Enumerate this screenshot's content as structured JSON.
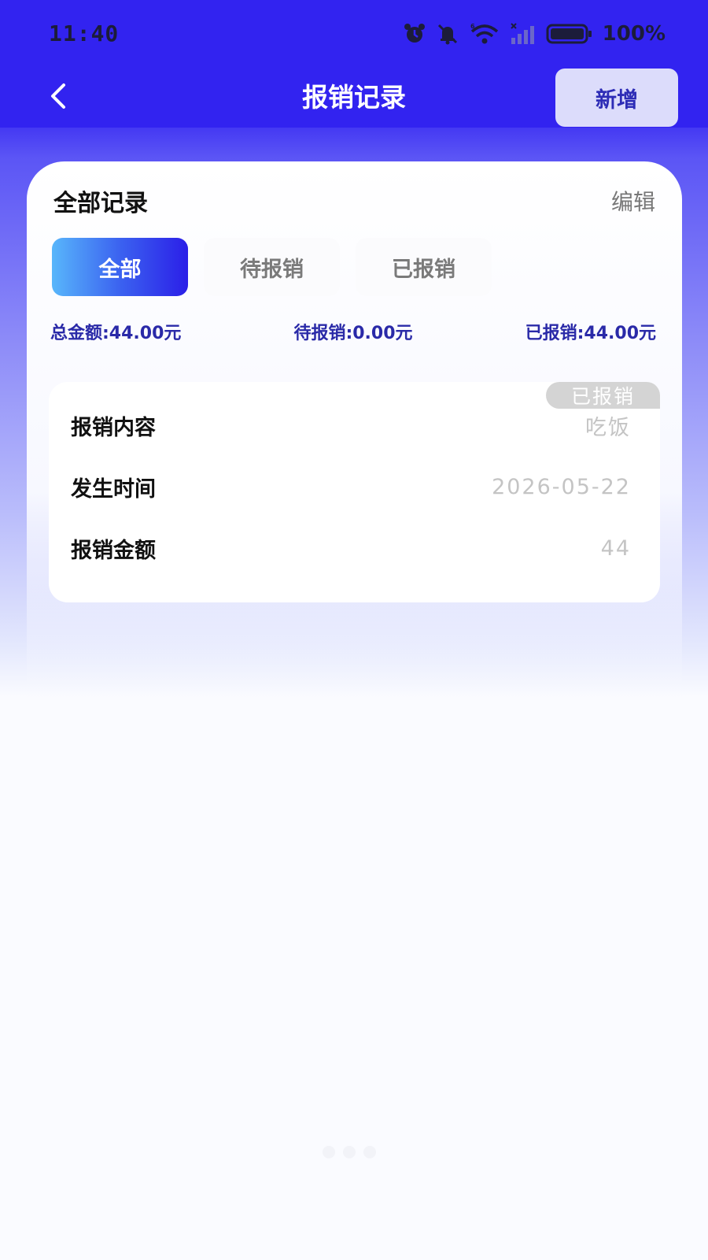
{
  "status_bar": {
    "time": "11:40",
    "battery_percent": "100%",
    "icons": [
      "alarm-icon",
      "mute-icon",
      "wifi-icon",
      "signal-icon",
      "battery-icon"
    ]
  },
  "nav": {
    "title": "报销记录",
    "add_label": "新增",
    "back_icon": "chevron-left-icon"
  },
  "card": {
    "title": "全部记录",
    "edit_label": "编辑",
    "tabs": [
      {
        "label": "全部",
        "active": true
      },
      {
        "label": "待报销",
        "active": false
      },
      {
        "label": "已报销",
        "active": false
      }
    ],
    "summary": {
      "total": "总金额:44.00元",
      "pending": "待报销:0.00元",
      "reimbursed": "已报销:44.00元"
    }
  },
  "records": [
    {
      "status": "已报销",
      "rows": [
        {
          "label": "报销内容",
          "value": "吃饭"
        },
        {
          "label": "发生时间",
          "value": "2026-05-22"
        },
        {
          "label": "报销金额",
          "value": "44"
        }
      ]
    }
  ],
  "colors": {
    "header": "#3223f0",
    "accent_text": "#2a2aa8",
    "tab_active_start": "#58b6fb",
    "tab_active_end": "#2b1fe8",
    "status_badge": "#d4d4d4"
  }
}
